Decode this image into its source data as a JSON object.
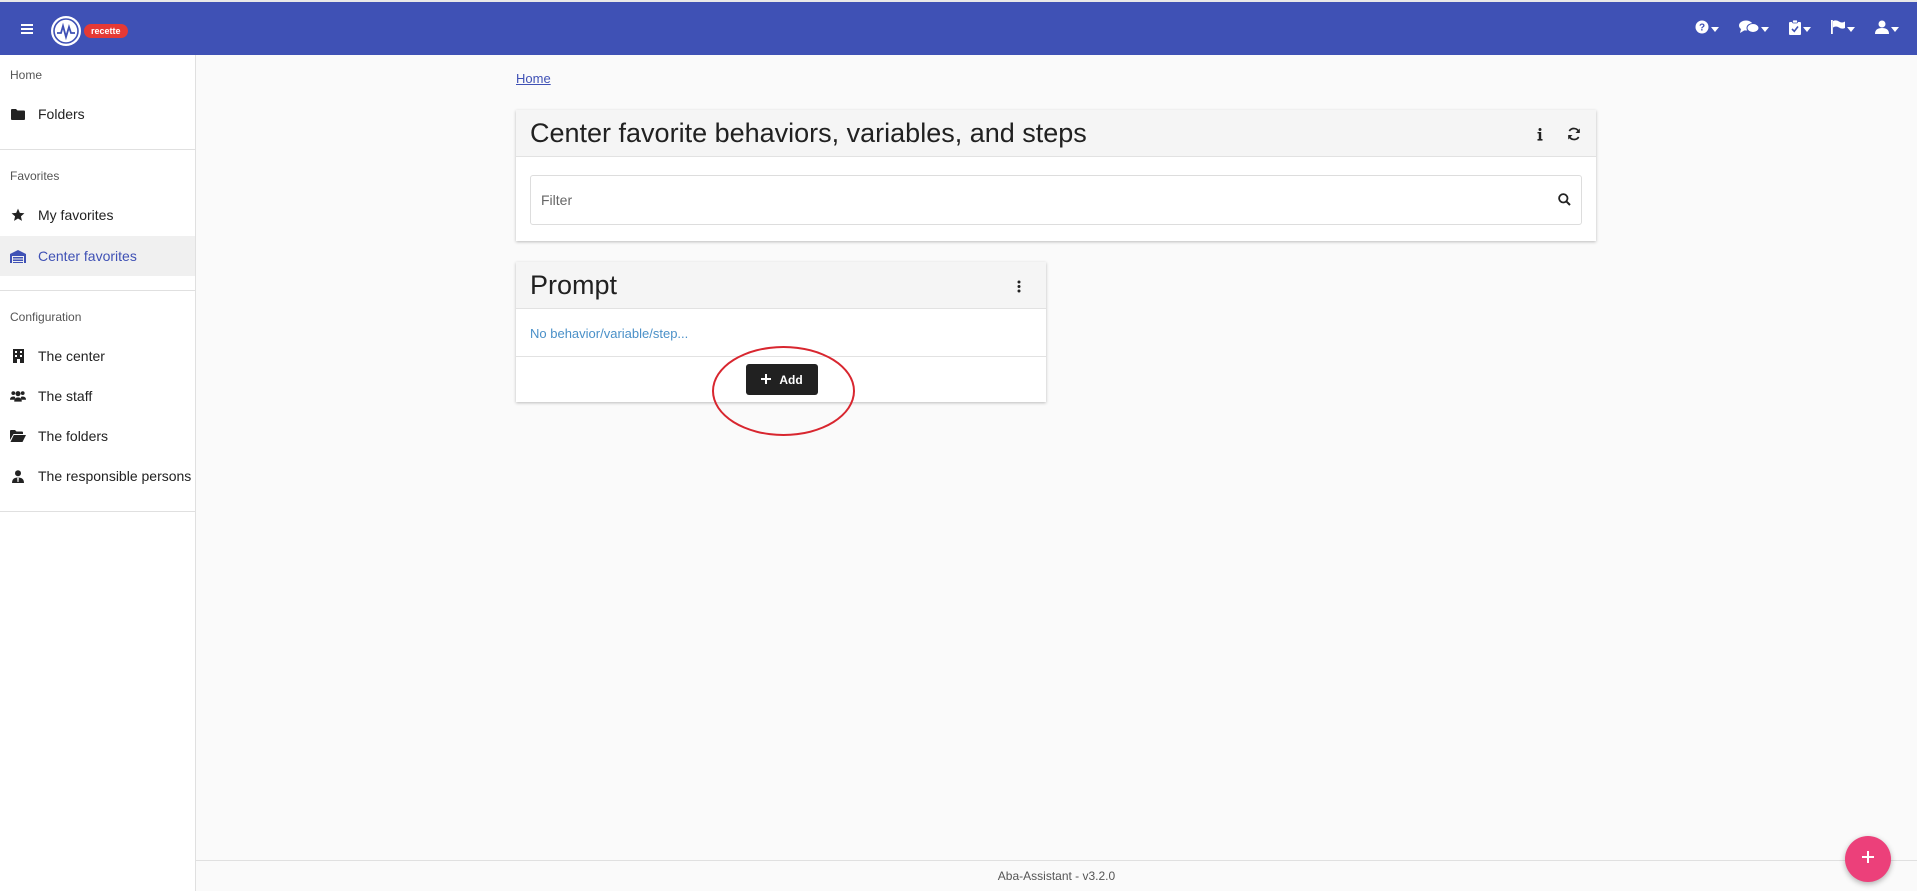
{
  "header": {
    "env_badge": "recette",
    "menu_icon": "menu-icon",
    "actions": [
      {
        "name": "help-menu",
        "icon": "question-circle-icon"
      },
      {
        "name": "messages-menu",
        "icon": "chat-bubbles-icon"
      },
      {
        "name": "tasks-menu",
        "icon": "clipboard-check-icon"
      },
      {
        "name": "flags-menu",
        "icon": "flag-icon"
      },
      {
        "name": "user-menu",
        "icon": "user-icon"
      }
    ]
  },
  "sidebar": {
    "home_title": "Home",
    "folders_label": "Folders",
    "favorites_title": "Favorites",
    "my_favorites_label": "My favorites",
    "center_favorites_label": "Center favorites",
    "configuration_title": "Configuration",
    "the_center_label": "The center",
    "the_staff_label": "The staff",
    "the_folders_label": "The folders",
    "responsible_persons_label": "The responsible persons"
  },
  "breadcrumb": {
    "home": "Home"
  },
  "main_card": {
    "title": "Center favorite behaviors, variables, and steps",
    "filter_placeholder": "Filter",
    "filter_value": ""
  },
  "prompt_card": {
    "title": "Prompt",
    "empty_message": "No behavior/variable/step...",
    "add_label": "Add"
  },
  "footer": {
    "version": "Aba-Assistant - v3.2.0"
  },
  "colors": {
    "primary": "#3f51b5",
    "badge": "#e53935",
    "fab": "#ec407a",
    "link": "#4a90c8",
    "annotation": "#d8262f"
  }
}
